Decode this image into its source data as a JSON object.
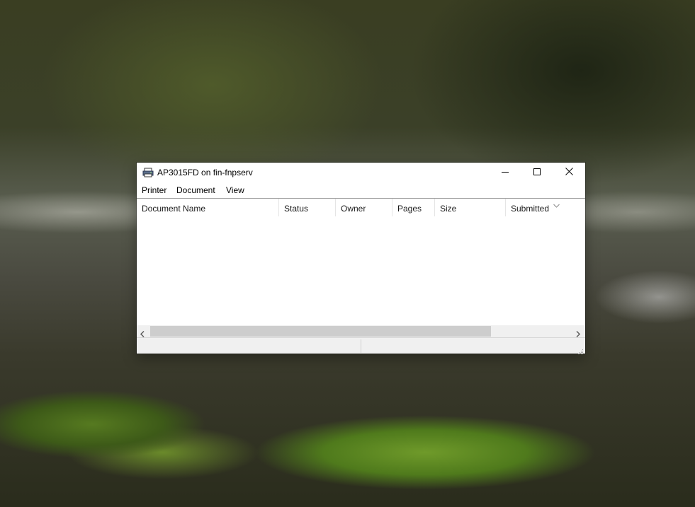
{
  "window": {
    "title": "AP3015FD on fin-fnpserv",
    "icon": "printer-icon"
  },
  "caption_buttons": {
    "minimize": "minimize-icon",
    "maximize": "maximize-icon",
    "close": "close-icon"
  },
  "menu": {
    "items": [
      {
        "label": "Printer"
      },
      {
        "label": "Document"
      },
      {
        "label": "View"
      }
    ]
  },
  "queue": {
    "columns": [
      {
        "label": "Document Name"
      },
      {
        "label": "Status"
      },
      {
        "label": "Owner"
      },
      {
        "label": "Pages"
      },
      {
        "label": "Size"
      },
      {
        "label": "Submitted"
      }
    ],
    "rows": []
  },
  "statusbar": {
    "left": "",
    "right": ""
  },
  "colors": {
    "window_bg": "#ffffff",
    "chrome_bg": "#f0f0f0",
    "scroll_thumb": "#cdcdcd"
  }
}
